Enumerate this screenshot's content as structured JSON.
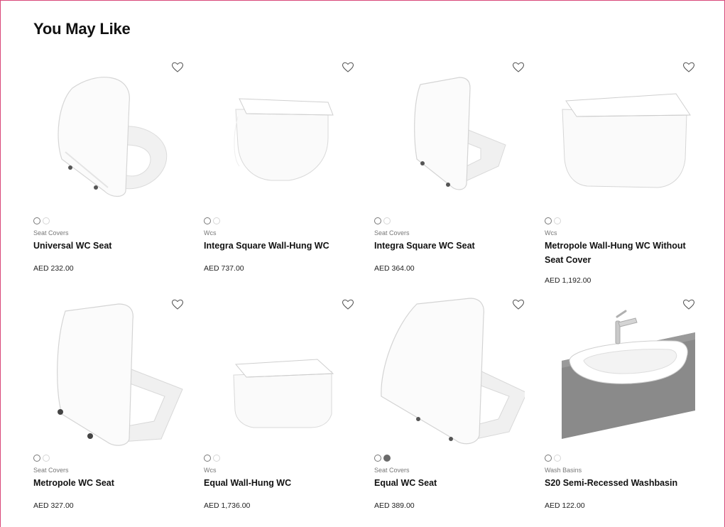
{
  "section": {
    "title": "You May Like"
  },
  "products": [
    {
      "category": "Seat Covers",
      "name": "Universal WC Seat",
      "price": "AED 232.00",
      "icon": "wc-seat",
      "swatches": [
        "white",
        "white"
      ]
    },
    {
      "category": "Wcs",
      "name": "Integra Square Wall-Hung WC",
      "price": "AED 737.00",
      "icon": "wall-hung-wc",
      "swatches": [
        "white",
        "white"
      ]
    },
    {
      "category": "Seat Covers",
      "name": "Integra Square WC Seat",
      "price": "AED 364.00",
      "icon": "wc-seat",
      "swatches": [
        "white",
        "white"
      ]
    },
    {
      "category": "Wcs",
      "name": "Metropole Wall-Hung WC Without Seat Cover",
      "price": "AED 1,192.00",
      "icon": "wall-hung-wc",
      "swatches": [
        "white",
        "white"
      ]
    },
    {
      "category": "Seat Covers",
      "name": "Metropole WC Seat",
      "price": "AED 327.00",
      "icon": "wc-seat",
      "swatches": [
        "white",
        "white"
      ]
    },
    {
      "category": "Wcs",
      "name": "Equal Wall-Hung WC",
      "price": "AED 1,736.00",
      "icon": "wall-hung-wc",
      "swatches": [
        "white",
        "white"
      ]
    },
    {
      "category": "Seat Covers",
      "name": "Equal WC Seat",
      "price": "AED 389.00",
      "icon": "wc-seat",
      "swatches": [
        "white",
        "grey"
      ]
    },
    {
      "category": "Wash Basins",
      "name": "S20 Semi-Recessed Washbasin",
      "price": "AED 122.00",
      "icon": "washbasin",
      "swatches": [
        "white",
        "white"
      ]
    }
  ],
  "colors": {
    "frame_border": "#d9487a",
    "text": "#111111",
    "category": "#777777"
  }
}
